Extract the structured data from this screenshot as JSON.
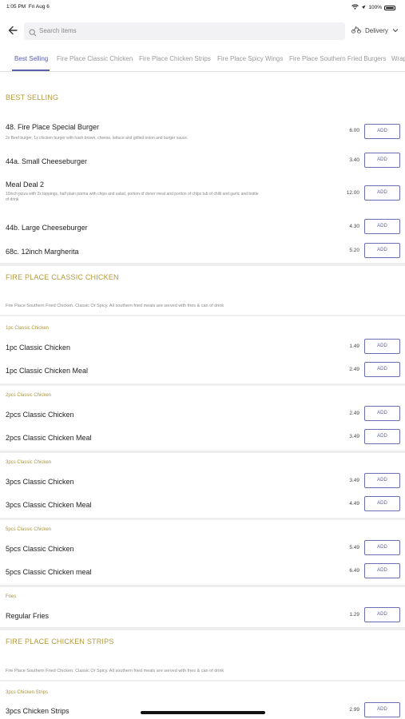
{
  "status": {
    "time": "1:05 PM",
    "date": "Fri Aug 6",
    "battery": "100%"
  },
  "search": {
    "placeholder": "Search items"
  },
  "delivery": {
    "label": "Delivery"
  },
  "tabs": [
    "Best Selling",
    "Fire Place Classic Chicken",
    "Fire Place Chicken Strips",
    "Fire Place Spicy Wings",
    "Fire Place Southern Fried Burgers",
    "Wrap"
  ],
  "add_label": "ADD",
  "best_selling": {
    "title": "BEST SELLING",
    "items": [
      {
        "name": "48. Fire Place Special Burger",
        "desc": "2x Beef burger, 1x chicken burger with hash brown, cheese, lettuce and grilled onion and burger sauce.",
        "price": "6.00"
      },
      {
        "name": "44a. Small Cheeseburger",
        "price": "3.40"
      },
      {
        "name": "Meal Deal 2",
        "desc": "10inch pizza with 2x toppings, half plain parma with chips and salad, portion of doner meat and portion of chips tub of chilli and garlic and bottle of drink",
        "price": "12.00"
      },
      {
        "name": "44b. Large Cheeseburger",
        "price": "4.30"
      },
      {
        "name": "68c. 12inch Margherita",
        "price": "5.20"
      }
    ]
  },
  "classic_chicken": {
    "title": "FIRE PLACE CLASSIC CHICKEN",
    "desc": "Fire Place Southern Fried Chicken. Classic Or Spicy. All southern fried meals are served with fries & can of drink",
    "groups": [
      {
        "title": "1pc Classic Chicken",
        "items": [
          {
            "name": "1pc Classic Chicken",
            "price": "1.49"
          },
          {
            "name": "1pc Classic Chicken Meal",
            "price": "2.49"
          }
        ]
      },
      {
        "title": "2pcs Classic Chicken",
        "items": [
          {
            "name": "2pcs Classic Chicken",
            "price": "2.49"
          },
          {
            "name": "2pcs Classic Chicken Meal",
            "price": "3.49"
          }
        ]
      },
      {
        "title": "3pcs Classic Chicken",
        "items": [
          {
            "name": "3pcs Classic Chicken",
            "price": "3.49"
          },
          {
            "name": "3pcs Classic Chicken Meal",
            "price": "4.49"
          }
        ]
      },
      {
        "title": "5pcs Classic Chicken",
        "items": [
          {
            "name": "5pcs Classic Chicken",
            "price": "5.49"
          },
          {
            "name": "5pcs Classic Chicken meal",
            "price": "6.49"
          }
        ]
      },
      {
        "title": "Fries",
        "items": [
          {
            "name": "Regular Fries",
            "price": "1.29"
          }
        ]
      }
    ]
  },
  "chicken_strips": {
    "title": "FIRE PLACE CHICKEN STRIPS",
    "desc": "Fire Place Southern Fried Chicken. Classic Or Spicy. All southern fried meals are served with fries & can of drink",
    "groups": [
      {
        "title": "3pcs Chicken Strips",
        "items": [
          {
            "name": "3pcs Chicken Strips",
            "price": "2.99"
          }
        ]
      }
    ]
  },
  "colors": {
    "accent": "#5a5fa8",
    "section_title": "#b29a3a"
  }
}
